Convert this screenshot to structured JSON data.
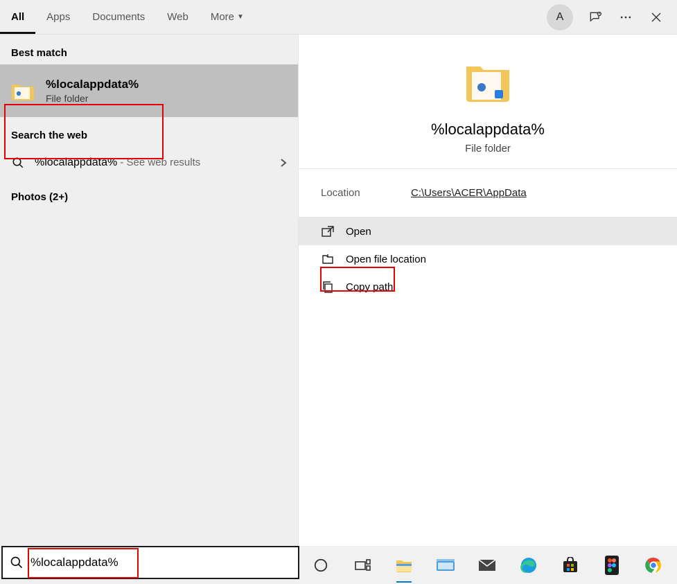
{
  "header": {
    "tabs": [
      {
        "label": "All",
        "active": true
      },
      {
        "label": "Apps"
      },
      {
        "label": "Documents"
      },
      {
        "label": "Web"
      },
      {
        "label": "More",
        "dropdown": true
      }
    ],
    "avatar_initial": "A"
  },
  "left": {
    "best_match_heading": "Best match",
    "best_match": {
      "title": "%localappdata%",
      "subtitle": "File folder"
    },
    "search_web_heading": "Search the web",
    "web_result": {
      "term": "%localappdata%",
      "suffix": " - See web results"
    },
    "photos_heading": "Photos (2+)"
  },
  "preview": {
    "title": "%localappdata%",
    "subtitle": "File folder",
    "location_label": "Location",
    "location_value": "C:\\Users\\ACER\\AppData",
    "actions": [
      {
        "label": "Open",
        "hover": true
      },
      {
        "label": "Open file location"
      },
      {
        "label": "Copy path"
      }
    ]
  },
  "search": {
    "value": "%localappdata%"
  },
  "taskbar_icons": [
    "cortana-icon",
    "taskview-icon",
    "explorer-icon",
    "keyboard-icon",
    "mail-icon",
    "edge-icon",
    "store-icon",
    "figma-icon",
    "chrome-icon"
  ]
}
